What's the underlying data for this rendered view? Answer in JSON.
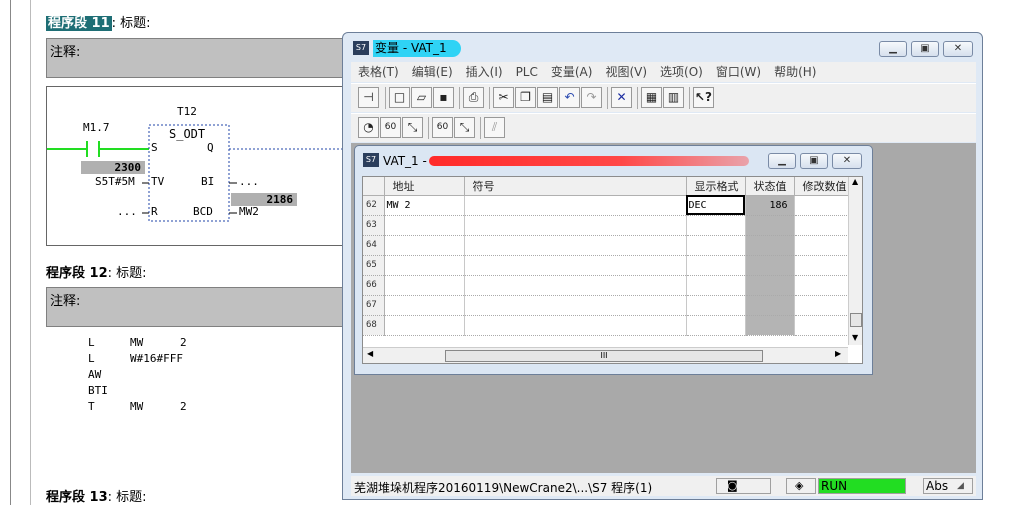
{
  "editor": {
    "network11": {
      "title_sel": "程序段 11",
      "title_rest": ": 标题:",
      "comment": "注释:"
    },
    "ladder": {
      "timer": "T12",
      "block": "S_ODT",
      "contact": "M1.7",
      "pin_s": "S",
      "pin_q": "Q",
      "pin_tv": "TV",
      "pin_bi": "BI",
      "pin_r": "R",
      "pin_bcd": "BCD",
      "tv_value": "2300",
      "tv_input": "S5T#5M",
      "bi_dots": "...",
      "r_dots": "...",
      "bi_value": "2186",
      "bcd_out": "MW2"
    },
    "network12": {
      "title": "程序段 12",
      "title_rest": ": 标题:",
      "comment": "注释:"
    },
    "stl": [
      {
        "op": "L",
        "arg": "MW",
        "val": "2"
      },
      {
        "op": "L",
        "arg": "W#16#FFF",
        "val": ""
      },
      {
        "op": "AW",
        "arg": "",
        "val": ""
      },
      {
        "op": "BTI",
        "arg": "",
        "val": ""
      },
      {
        "op": "T",
        "arg": "MW",
        "val": "2"
      }
    ],
    "network13": {
      "title": "程序段 13",
      "title_rest": ": 标题:"
    }
  },
  "vat_window": {
    "title": "变量 - VAT_1",
    "menu": [
      "表格(T)",
      "编辑(E)",
      "插入(I)",
      "PLC",
      "变量(A)",
      "视图(V)",
      "选项(O)",
      "窗口(W)",
      "帮助(H)"
    ],
    "toolbar1_icons": [
      "pin-icon",
      "new-icon",
      "open-icon",
      "save-icon",
      "print-icon",
      "cut-icon",
      "copy-icon",
      "paste-icon",
      "undo-icon",
      "redo-icon",
      "delete-icon",
      "plc-online-icon",
      "plc-config-icon",
      "help-icon"
    ],
    "toolbar2_icons": [
      "monitor-icon",
      "monitor-once-icon",
      "modify-icon",
      "monitor-trigger-icon",
      "modify-trigger-icon",
      "force-icon"
    ],
    "status": {
      "path": "芜湖堆垛机程序20160119\\NewCrane2\\...\\S7 程序(1)",
      "run": "RUN",
      "mode": "Abs"
    }
  },
  "vat_inner": {
    "title": "VAT_1 -",
    "columns": [
      "",
      "地址",
      "符号",
      "显示格式",
      "状态值",
      "修改数值"
    ],
    "rows": [
      {
        "n": "62",
        "addr": "MW     2",
        "sym": "",
        "fmt": "DEC",
        "stat": "186",
        "mod": ""
      },
      {
        "n": "63",
        "addr": "",
        "sym": "",
        "fmt": "",
        "stat": "",
        "mod": ""
      },
      {
        "n": "64",
        "addr": "",
        "sym": "",
        "fmt": "",
        "stat": "",
        "mod": ""
      },
      {
        "n": "65",
        "addr": "",
        "sym": "",
        "fmt": "",
        "stat": "",
        "mod": ""
      },
      {
        "n": "66",
        "addr": "",
        "sym": "",
        "fmt": "",
        "stat": "",
        "mod": ""
      },
      {
        "n": "67",
        "addr": "",
        "sym": "",
        "fmt": "",
        "stat": "",
        "mod": ""
      },
      {
        "n": "68",
        "addr": "",
        "sym": "",
        "fmt": "",
        "stat": "",
        "mod": ""
      }
    ],
    "scroll_thumb_glyph": "III"
  },
  "colors": {
    "run": "#22dd22",
    "title_highlight": "#2fd3f5",
    "network_sel": "#1e6e75"
  }
}
